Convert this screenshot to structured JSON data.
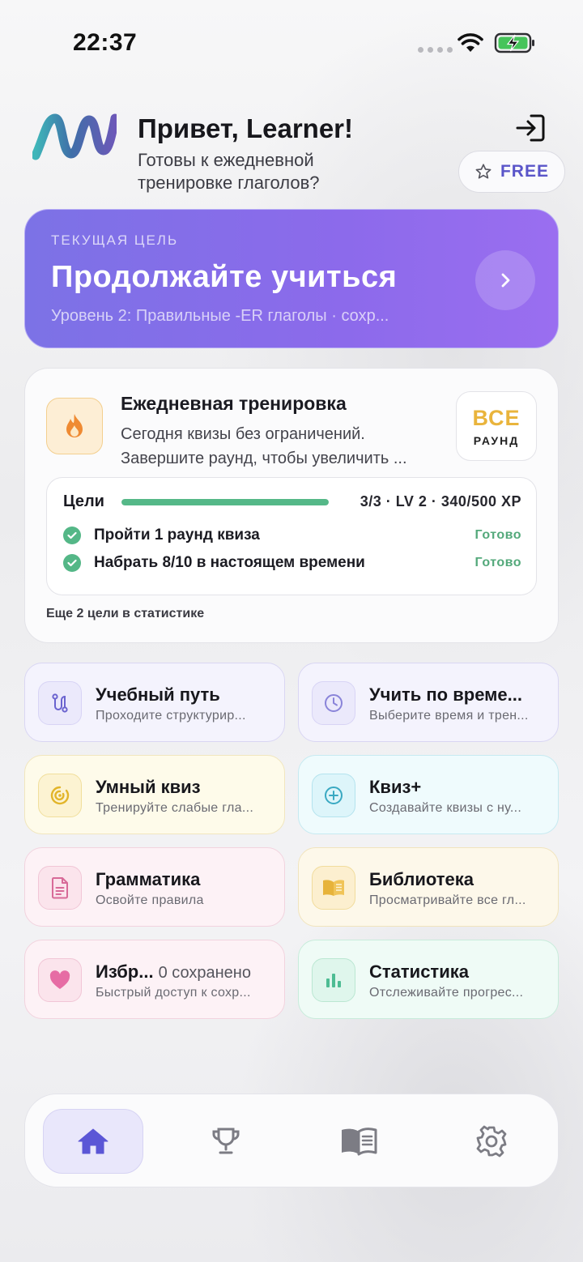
{
  "status_bar": {
    "time": "22:37"
  },
  "header": {
    "greeting": "Привет, Learner!",
    "subtitle": "Готовы к ежедневной тренировке глаголов?",
    "plan_label": "FREE"
  },
  "goal_banner": {
    "kicker": "ТЕКУЩАЯ ЦЕЛЬ",
    "title": "Продолжайте учиться",
    "subtitle": "Уровень 2: Правильные -ER глаголы · сохр..."
  },
  "daily": {
    "title": "Ежедневная тренировка",
    "line1": "Сегодня квизы без ограничений.",
    "line2": "Завершите раунд, чтобы увеличить ...",
    "badge_big": "ВСЕ",
    "badge_small": "РАУНД",
    "goals_label": "Цели",
    "goals_progress": 1.0,
    "goals_stats": "3/3 · LV 2 · 340/500 XP",
    "goals": [
      {
        "text": "Пройти 1 раунд квиза",
        "status": "Готово"
      },
      {
        "text": "Набрать 8/10 в настоящем времени",
        "status": "Готово"
      }
    ],
    "footer": "Еще 2 цели в статистике"
  },
  "tiles": [
    {
      "title": "Учебный путь",
      "subtitle": "Проходите структурир...",
      "icon": "path-icon",
      "theme": "purple"
    },
    {
      "title": "Учить по време...",
      "subtitle": "Выберите время и трен...",
      "icon": "clock-icon",
      "theme": "purple"
    },
    {
      "title": "Умный квиз",
      "subtitle": "Тренируйте слабые гла...",
      "icon": "target-icon",
      "theme": "yellow"
    },
    {
      "title": "Квиз+",
      "subtitle": "Создавайте квизы с ну...",
      "icon": "plus-circle-icon",
      "theme": "cyan"
    },
    {
      "title": "Грамматика",
      "subtitle": "Освойте правила",
      "icon": "document-icon",
      "theme": "pink"
    },
    {
      "title": "Библиотека",
      "subtitle": "Просматривайте все гл...",
      "icon": "book-icon",
      "theme": "amber"
    },
    {
      "title": "Избр...",
      "count": "0 сохранено",
      "subtitle": "Быстрый доступ к сохр...",
      "icon": "heart-icon",
      "theme": "pink"
    },
    {
      "title": "Статистика",
      "subtitle": "Отслеживайте прогрес...",
      "icon": "bar-chart-icon",
      "theme": "mint"
    }
  ],
  "nav": {
    "items": [
      {
        "name": "home",
        "icon": "home-icon",
        "active": true
      },
      {
        "name": "trophy",
        "icon": "trophy-icon",
        "active": false
      },
      {
        "name": "library",
        "icon": "open-book-icon",
        "active": false
      },
      {
        "name": "settings",
        "icon": "gear-icon",
        "active": false
      }
    ]
  },
  "colors": {
    "accent": "#5a55c9",
    "banner_start": "#7c72e6",
    "banner_end": "#9a6ef0",
    "success": "#54b787",
    "badge_gold": "#e9b43c"
  }
}
